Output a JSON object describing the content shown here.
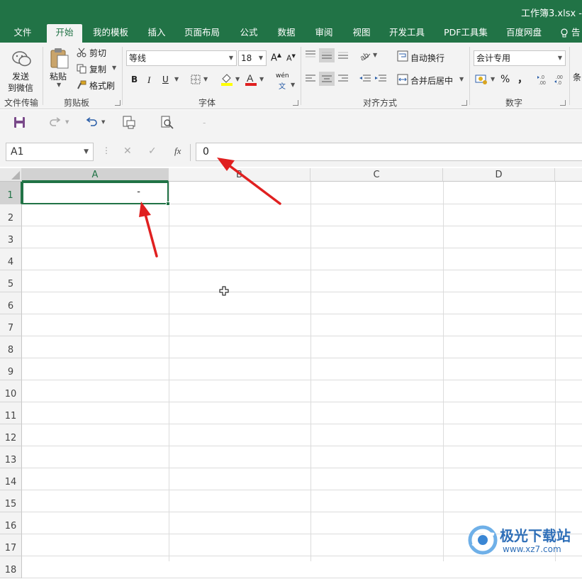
{
  "window": {
    "title": "工作簿3.xlsx -"
  },
  "ribbon_tabs": [
    {
      "label": "文件"
    },
    {
      "label": "开始"
    },
    {
      "label": "我的模板"
    },
    {
      "label": "插入"
    },
    {
      "label": "页面布局"
    },
    {
      "label": "公式"
    },
    {
      "label": "数据"
    },
    {
      "label": "审阅"
    },
    {
      "label": "视图"
    },
    {
      "label": "开发工具"
    },
    {
      "label": "PDF工具集"
    },
    {
      "label": "百度网盘"
    },
    {
      "label": "告"
    }
  ],
  "active_tab": "开始",
  "ribbon": {
    "wechat": {
      "line1": "发送",
      "line2": "到微信",
      "group": "文件传输"
    },
    "clipboard": {
      "paste": "粘贴",
      "cut": "剪切",
      "copy": "复制",
      "format_painter": "格式刷",
      "group": "剪贴板"
    },
    "font": {
      "name": "等线",
      "size": "18",
      "bold": "B",
      "italic": "I",
      "underline": "U",
      "phonetic": "wén",
      "group": "字体"
    },
    "alignment": {
      "wrap": "自动换行",
      "merge": "合并后居中",
      "group": "对齐方式"
    },
    "number": {
      "format": "会计专用",
      "percent": "%",
      "comma": "，",
      "group": "数字"
    },
    "extra": {
      "label": "条"
    }
  },
  "formula_bar": {
    "name_box": "A1",
    "value": "0",
    "cancel": "✕",
    "enter": "✓",
    "fx": "fx"
  },
  "columns": [
    "A",
    "B",
    "C",
    "D"
  ],
  "rows": [
    "1",
    "2",
    "3",
    "4",
    "5",
    "6",
    "7",
    "8",
    "9",
    "10",
    "11",
    "12",
    "13",
    "14",
    "15",
    "16",
    "17",
    "18"
  ],
  "active_cell": {
    "ref": "A1",
    "display": "-"
  },
  "watermark": {
    "brand": "极光下载站",
    "url": "www.xz7.com"
  },
  "colors": {
    "accent": "#217346",
    "annotation_arrow": "#e02020"
  }
}
